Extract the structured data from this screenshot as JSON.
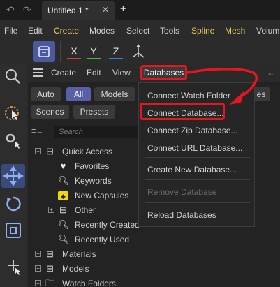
{
  "titlebar": {
    "doc_tab": "Untitled 1 *",
    "close": "✕",
    "new_tab": "+"
  },
  "menubar": {
    "items": [
      {
        "label": "File",
        "color": "#d0d0d0"
      },
      {
        "label": "Edit",
        "color": "#d0d0d0"
      },
      {
        "label": "Create",
        "color": "#e6c95a"
      },
      {
        "label": "Modes",
        "color": "#d0d0d0"
      },
      {
        "label": "Select",
        "color": "#d0d0d0"
      },
      {
        "label": "Tools",
        "color": "#d0d0d0"
      },
      {
        "label": "Spline",
        "color": "#e6c95a"
      },
      {
        "label": "Mesh",
        "color": "#e6c95a"
      },
      {
        "label": "Volum",
        "color": "#d0d0d0"
      }
    ]
  },
  "toolbar": {
    "axes": [
      {
        "label": "X",
        "color": "#e03a3a"
      },
      {
        "label": "Y",
        "color": "#3ac03a"
      },
      {
        "label": "Z",
        "color": "#3a7ae0"
      }
    ]
  },
  "panel": {
    "toolbar": {
      "create": "Create",
      "edit": "Edit",
      "view": "View",
      "databases": "Databases"
    },
    "filters": [
      "Auto",
      "All",
      "Models",
      "Scenes",
      "Presets"
    ],
    "filters_partial": "es",
    "search_placeholder": "Search",
    "tree": [
      {
        "label": "Quick Access",
        "icon": "box-stack-icon",
        "level": 0,
        "expander": "⊟"
      },
      {
        "label": "Favorites",
        "icon": "heart-icon",
        "level": 1
      },
      {
        "label": "Keywords",
        "icon": "magnifier-icon",
        "level": 1
      },
      {
        "label": "New Capsules",
        "icon": "capsule-icon",
        "level": 1
      },
      {
        "label": "Other",
        "icon": "box-stack-icon",
        "level": 1,
        "expander": "⊞"
      },
      {
        "label": "Recently Created",
        "icon": "magnifier-icon",
        "level": 1
      },
      {
        "label": "Recently Used",
        "icon": "magnifier-icon",
        "level": 1
      },
      {
        "label": "Materials",
        "icon": "box-stack-icon",
        "level": 0,
        "expander": "⊞"
      },
      {
        "label": "Models",
        "icon": "box-stack-icon",
        "level": 0,
        "expander": "⊞"
      },
      {
        "label": "Watch Folders",
        "icon": "folder-icon",
        "level": 0,
        "expander": "⊞"
      }
    ]
  },
  "dropdown": {
    "items": [
      {
        "label": "Connect Watch Folder",
        "disabled": false
      },
      {
        "label": "Connect Database...",
        "disabled": false,
        "highlighted": true
      },
      {
        "label": "Connect Zip Database...",
        "disabled": false
      },
      {
        "label": "Connect URL Database...",
        "disabled": false
      },
      {
        "label": "Create New Database...",
        "disabled": false
      },
      {
        "label": "Remove Database",
        "disabled": true
      },
      {
        "label": "Reload Databases",
        "disabled": false
      }
    ]
  },
  "colors": {
    "accent": "#5a5faa",
    "annotation_red": "#e41620"
  }
}
